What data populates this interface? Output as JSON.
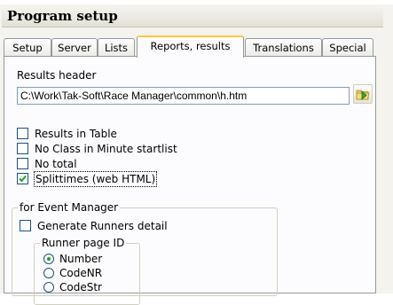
{
  "window": {
    "title": "Program setup"
  },
  "tabs": [
    {
      "label": "Setup",
      "active": false
    },
    {
      "label": "Server",
      "active": false
    },
    {
      "label": "Lists",
      "active": false
    },
    {
      "label": "Reports, results",
      "active": true
    },
    {
      "label": "Translations",
      "active": false
    },
    {
      "label": "Special",
      "active": false
    }
  ],
  "results_header": {
    "label": "Results header",
    "value": "C:\\Work\\Tak-Soft\\Race Manager\\common\\h.htm",
    "browse_icon": "folder-icon"
  },
  "options": [
    {
      "label": "Results in Table",
      "checked": false
    },
    {
      "label": "No Class in Minute startlist",
      "checked": false
    },
    {
      "label": "No total",
      "checked": false
    },
    {
      "label": "Splittimes (web HTML)",
      "checked": true
    }
  ],
  "event_manager": {
    "title": "for Event Manager",
    "generate_label": "Generate Runners detail",
    "generate_checked": false,
    "runner_page": {
      "title": "Runner page ID",
      "options": [
        {
          "label": "Number",
          "selected": true
        },
        {
          "label": "CodeNR",
          "selected": false
        },
        {
          "label": "CodeStr",
          "selected": false
        }
      ]
    }
  },
  "colors": {
    "active_tab_accent": "#ffc73c",
    "check_mark": "#21a121",
    "control_border": "#1c5180"
  }
}
